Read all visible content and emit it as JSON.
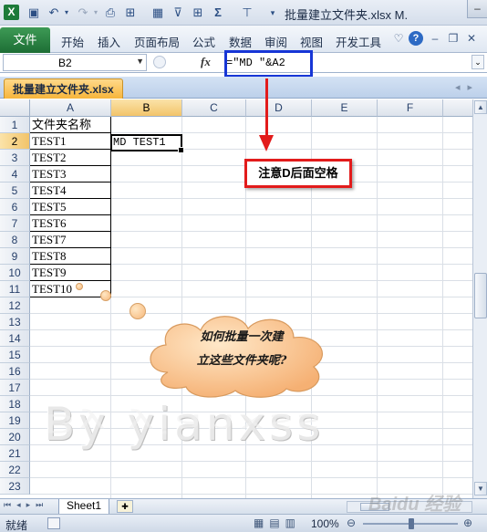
{
  "window": {
    "title": "批量建立文件夹.xlsx M.",
    "app_icon": "X"
  },
  "ribbon": {
    "file_tab": "文件",
    "tabs": [
      "开始",
      "插入",
      "页面布局",
      "公式",
      "数据",
      "审阅",
      "视图",
      "开发工具"
    ],
    "help": "?"
  },
  "formula_bar": {
    "name_box": "B2",
    "fx": "fx",
    "formula": "=\"MD \"&A2"
  },
  "workbook_tab": {
    "label": "批量建立文件夹.xlsx"
  },
  "grid": {
    "columns": [
      "A",
      "B",
      "C",
      "D",
      "E",
      "F"
    ],
    "rows": [
      "1",
      "2",
      "3",
      "4",
      "5",
      "6",
      "7",
      "8",
      "9",
      "10",
      "11",
      "12",
      "13",
      "14",
      "15",
      "16",
      "17",
      "18",
      "19",
      "20",
      "21",
      "22",
      "23"
    ],
    "col_a": [
      "文件夹名称",
      "TEST1",
      "TEST2",
      "TEST3",
      "TEST4",
      "TEST5",
      "TEST6",
      "TEST7",
      "TEST8",
      "TEST9",
      "TEST10"
    ],
    "b2": "MD TEST1",
    "active_col": "B",
    "active_row": "2"
  },
  "annotation": {
    "note": "注意D后面空格",
    "cloud_line1": "如何批量一次建",
    "cloud_line2": "立这些文件夹呢?",
    "watermark": "By yianxss"
  },
  "sheets": {
    "active": "Sheet1"
  },
  "status": {
    "ready": "就绪",
    "zoom": "100%",
    "baidu_watermark": "Baidu 经验"
  },
  "colors": {
    "highlight_blue": "#1736d6",
    "annotation_red": "#e21b1b",
    "excel_green": "#1d6e35"
  }
}
